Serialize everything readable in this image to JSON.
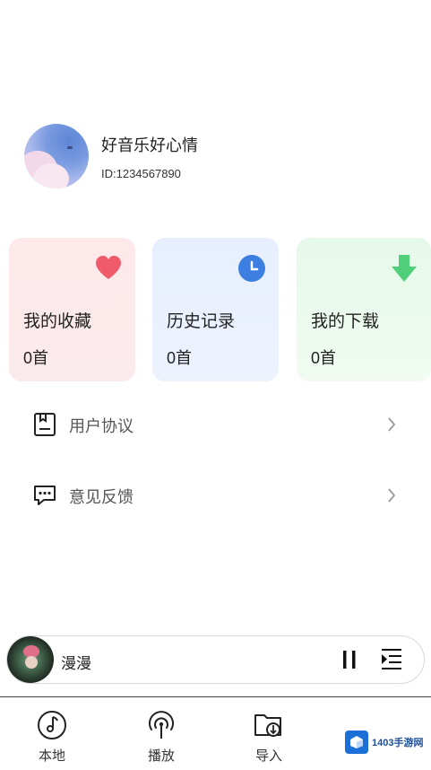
{
  "profile": {
    "username": "好音乐好心情",
    "user_id": "ID:1234567890"
  },
  "cards": [
    {
      "title": "我的收藏",
      "count": "0首",
      "icon": "heart-icon",
      "accent": "#ef5b6b"
    },
    {
      "title": "历史记录",
      "count": "0首",
      "icon": "clock-icon",
      "accent": "#3d7fe0"
    },
    {
      "title": "我的下载",
      "count": "0首",
      "icon": "download-arrow-icon",
      "accent": "#4fcf79"
    }
  ],
  "menu": [
    {
      "label": "用户协议",
      "icon": "document-icon"
    },
    {
      "label": "意见反馈",
      "icon": "chat-bubble-icon"
    }
  ],
  "player": {
    "song_title": "漫漫",
    "state": "playing"
  },
  "tabs": [
    {
      "label": "本地",
      "icon": "music-note-icon"
    },
    {
      "label": "播放",
      "icon": "broadcast-icon"
    },
    {
      "label": "导入",
      "icon": "folder-import-icon"
    }
  ],
  "watermark": {
    "text": "1403手游网"
  }
}
